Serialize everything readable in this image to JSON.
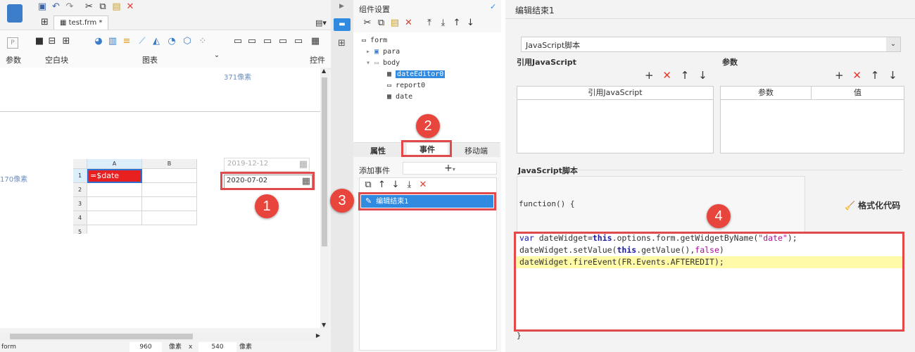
{
  "designer": {
    "file_tab": "test.frm *",
    "ribbon_groups": [
      "参数",
      "空白块",
      "图表",
      "控件"
    ],
    "ruler_width_label": "371像素",
    "ruler_height_label": "170像素",
    "grid": {
      "col_a": "A",
      "col_b": "B",
      "rows": [
        "1",
        "2",
        "3",
        "4",
        "5"
      ],
      "cell_a1": "=$date"
    },
    "date_placeholder": "2019-12-12",
    "date_value": "2020-07-02",
    "status": {
      "name": "form",
      "width": "960",
      "unit1": "像素",
      "x": "x",
      "height": "540",
      "unit2": "像素"
    }
  },
  "component_settings": {
    "title": "组件设置",
    "tree": {
      "root": "form",
      "para": "para",
      "body": "body",
      "children": [
        "dateEditor0",
        "report0",
        "date"
      ]
    },
    "tabs": [
      "属性",
      "事件",
      "移动端"
    ],
    "add_event_label": "添加事件",
    "add_event_plus": "+",
    "event_item": "编辑结束1"
  },
  "editor": {
    "title": "编辑结束1",
    "type_select": "JavaScript脚本",
    "ref_js_label": "引用JavaScript",
    "params_label": "参数",
    "ref_js_col": "引用JavaScript",
    "params_col": "参数",
    "value_col": "值",
    "script_label": "JavaScript脚本",
    "function_header": "function() {",
    "format_code": "格式化代码",
    "code_line1_pre": "var",
    "code_line1_mid": " dateWidget=",
    "code_line1_this": "this",
    "code_line1_call": ".options.form.getWidgetByName(",
    "code_line1_str": "\"date\"",
    "code_line1_end": ");",
    "code_line2_pre": "dateWidget.setValue(",
    "code_line2_this": "this",
    "code_line2_mid": ".getValue(),",
    "code_line2_false": "false",
    "code_line2_end": ")",
    "code_line3": "dateWidget.fireEvent(FR.Events.AFTEREDIT);",
    "closing_brace": "}"
  },
  "callouts": [
    "1",
    "2",
    "3",
    "4"
  ],
  "colors": {
    "accent_red": "#e2494b",
    "selection_blue": "#2f8ae0",
    "keyword_blue": "#1a1aa6",
    "string_purple": "#a31592"
  }
}
